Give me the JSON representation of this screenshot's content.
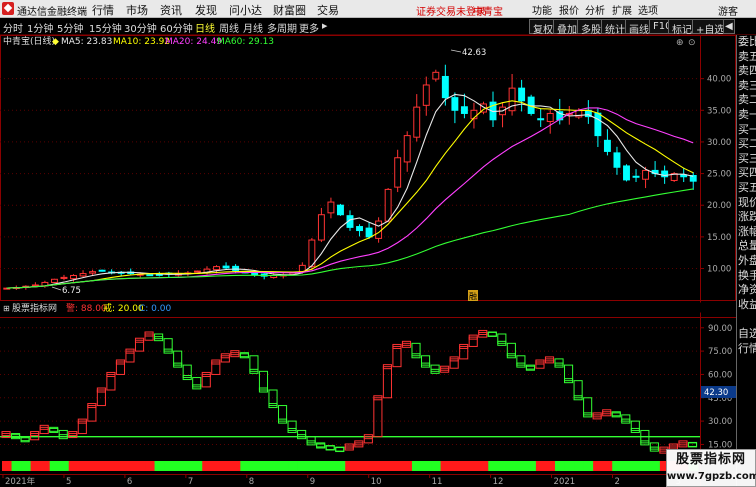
{
  "topbar": {
    "app_title": "通达信金融终端",
    "menu": [
      "行情",
      "市场",
      "资讯",
      "发现",
      "问小达",
      "财富圈",
      "交易"
    ],
    "login_status": "证券交易未登录",
    "stock_name": "中青宝",
    "tools": [
      "功能",
      "报价",
      "分析",
      "扩展",
      "选项"
    ],
    "guest": "游客"
  },
  "periodbar": {
    "periods": [
      "分时",
      "1分钟",
      "5分钟",
      "15分钟",
      "30分钟",
      "60分钟",
      "日线",
      "周线",
      "月线",
      "多周期",
      "更多"
    ],
    "active": "日线",
    "more_arrow": "▶",
    "right_tools": [
      "复权",
      "叠加",
      "多股",
      "统计",
      "画线",
      "F10",
      "标记",
      "+自选"
    ],
    "arrow": "◀"
  },
  "main_chart": {
    "title": "中青宝(日线)",
    "legend": [
      {
        "label": "MA5: 23.83",
        "color": "#e8e8e8"
      },
      {
        "label": "MA10: 23.92",
        "color": "#ffff00"
      },
      {
        "label": "MA20: 24.49",
        "color": "#ff40ff"
      },
      {
        "label": "MA60: 29.13",
        "color": "#33ff33"
      }
    ],
    "high_label": "42.63",
    "low_label": "6.75",
    "event_marker": "融",
    "bg_color": "#000000",
    "up_color": "#ff3333",
    "down_color": "#00ffff"
  },
  "indicator": {
    "name": "股票指标网",
    "labels": [
      {
        "label": "警: 88.00",
        "color": "#ff3333"
      },
      {
        "label": "戒: 20.00",
        "color": "#ffff00"
      },
      {
        "label": "C: 0.00",
        "color": "#3399ff"
      }
    ],
    "current_value": "42.30"
  },
  "chart_data": [
    {
      "type": "candlestick",
      "title": "中青宝(日线)",
      "y_ticks": [
        10.0,
        15.0,
        20.0,
        25.0,
        30.0,
        35.0,
        40.0
      ],
      "ylim": [
        5.5,
        45.0
      ],
      "close": [
        6.9,
        7.0,
        7.2,
        7.4,
        7.8,
        8.3,
        8.6,
        8.9,
        9.2,
        9.5,
        9.6,
        9.4,
        9.3,
        9.2,
        9.1,
        9.0,
        9.05,
        9.1,
        9.2,
        9.3,
        9.6,
        9.9,
        10.3,
        10.1,
        9.7,
        9.3,
        9.0,
        8.8,
        8.9,
        9.0,
        9.3,
        10.5,
        14.5,
        18.5,
        20.5,
        18.5,
        16.5,
        16.0,
        15.0,
        17.5,
        22.5,
        27.5,
        31.0,
        35.5,
        39.0,
        41.0,
        37.0,
        35.0,
        34.5,
        35.0,
        36.0,
        33.5,
        35.5,
        38.5,
        36.5,
        34.5,
        33.5,
        34.5,
        33.5,
        34.5,
        35.0,
        34.0,
        31.0,
        28.5,
        26.0,
        24.0,
        24.5,
        25.5,
        25.0,
        24.5,
        25.0,
        24.5,
        23.8
      ],
      "series": [
        {
          "name": "MA5",
          "value": 23.83,
          "color": "#e8e8e8"
        },
        {
          "name": "MA10",
          "value": 23.92,
          "color": "#ffff00"
        },
        {
          "name": "MA20",
          "value": 24.49,
          "color": "#ff40ff"
        },
        {
          "name": "MA60",
          "value": 29.13,
          "color": "#33ff33"
        }
      ],
      "annotations": [
        {
          "text": "42.63",
          "kind": "max"
        },
        {
          "text": "6.75",
          "kind": "min"
        }
      ]
    },
    {
      "type": "line",
      "title": "股票指标网",
      "y_ticks": [
        15.0,
        30.0,
        45.0,
        60.0,
        75.0,
        90.0
      ],
      "ylim": [
        5.0,
        95.0
      ],
      "thresholds": [
        {
          "name": "警",
          "value": 88.0
        },
        {
          "name": "戒",
          "value": 20.0
        }
      ],
      "current": 42.3,
      "x_labels": [
        "2021年",
        "5",
        "6",
        "7",
        "8",
        "9",
        "10",
        "11",
        "12",
        "2021",
        "2",
        "3"
      ],
      "values": [
        22,
        20,
        18,
        22,
        26,
        24,
        20,
        22,
        30,
        40,
        50,
        60,
        68,
        75,
        82,
        86,
        83,
        75,
        66,
        58,
        52,
        60,
        68,
        72,
        74,
        72,
        62,
        50,
        40,
        30,
        24,
        20,
        16,
        14,
        13,
        12,
        14,
        16,
        20,
        45,
        65,
        78,
        80,
        72,
        66,
        62,
        64,
        70,
        78,
        84,
        87,
        86,
        80,
        72,
        66,
        64,
        68,
        70,
        66,
        56,
        45,
        34,
        34,
        36,
        34,
        30,
        24,
        16,
        12,
        12,
        14,
        16,
        15
      ]
    }
  ],
  "side_panel": {
    "items": [
      "委比",
      "卖五",
      "卖四",
      "卖三",
      "卖二",
      "卖一",
      "买一",
      "买二",
      "买三",
      "买四",
      "买五",
      "现价",
      "涨跌",
      "涨幅",
      "总量",
      "外盘",
      "换手",
      "净资",
      "收益",
      "",
      "自选",
      "行情"
    ]
  },
  "watermark": {
    "line1": "股票指标网",
    "line2": "www.7gpzb.com"
  }
}
